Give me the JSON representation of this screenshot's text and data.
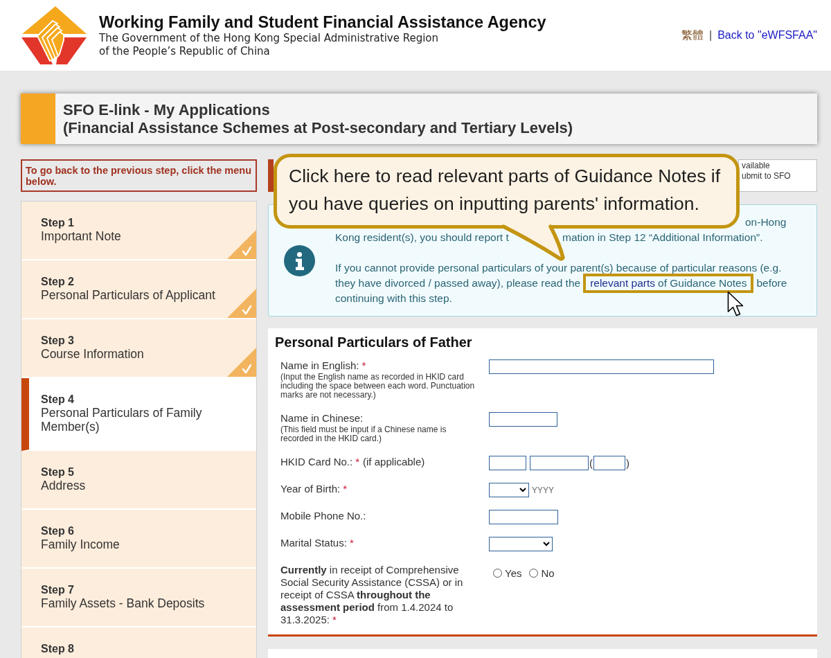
{
  "header": {
    "agency_name": "Working Family and Student Financial Assistance Agency",
    "government_lines": [
      "The Government of the Hong Kong Special Administrative Region",
      "of the People’s Republic of China"
    ],
    "links": [
      {
        "label": "繁體",
        "kind": "language"
      },
      {
        "label": "Back to \"eWFSFAA\"",
        "kind": "back"
      }
    ],
    "separator": "|"
  },
  "banner": {
    "title": "SFO E-link - My Applications",
    "subtitle": "(Financial Assistance Schemes at Post-secondary and Tertiary Levels)"
  },
  "navigation_note": "To go back to the previous step, click the menu below.",
  "steps": [
    {
      "label": "Step 1",
      "title": "Important Note",
      "completed": true,
      "selected": false
    },
    {
      "label": "Step 2",
      "title": "Personal Particulars of Applicant",
      "completed": true,
      "selected": false
    },
    {
      "label": "Step 3",
      "title": "Course Information",
      "completed": true,
      "selected": false
    },
    {
      "label": "Step 4",
      "title": "Personal Particulars of Family Member(s)",
      "completed": false,
      "selected": true
    },
    {
      "label": "Step 5",
      "title": "Address",
      "completed": false,
      "selected": false
    },
    {
      "label": "Step 6",
      "title": "Family Income",
      "completed": false,
      "selected": false
    },
    {
      "label": "Step 7",
      "title": "Family Assets - Bank Deposits",
      "completed": false,
      "selected": false
    },
    {
      "label": "Step 8",
      "completed": false,
      "selected": false
    }
  ],
  "status_box": {
    "lines": [
      "vailable",
      "ubmit to SFO"
    ]
  },
  "callout": {
    "text": "Click here to read relevant parts of Guidance Notes if you have queries on inputting parents' information."
  },
  "info": {
    "paragraphs": [
      {
        "lines": [
          [
            {
              "kind": "text",
              "text": "on-Hong"
            }
          ],
          [
            {
              "kind": "text",
              "text": "Kong resident(s), you should report t"
            },
            {
              "kind": "text",
              "text": "mation in Step 12 “Additional Information”."
            }
          ]
        ]
      },
      {
        "lines": [
          [
            {
              "kind": "text",
              "text": "If you cannot provide personal particulars of your parent(s) because of particular reasons (e.g."
            }
          ],
          [
            {
              "kind": "text",
              "text": "they have divorced / passed away), please read the"
            },
            {
              "kind": "frame",
              "link": "relevant parts",
              "text": "of Guidance Notes"
            },
            {
              "kind": "text",
              "text": "before"
            }
          ],
          [
            {
              "kind": "text",
              "text": "continuing with this step."
            }
          ]
        ]
      }
    ]
  },
  "form": {
    "title": "Personal Particulars of Father",
    "fields": [
      {
        "kind": "text",
        "label": "Name in English:",
        "mark": "*",
        "hint": "(Input the English name as recorded in HKID card including the space between each word. Punctuation marks are not necessary.)"
      },
      {
        "kind": "text",
        "label": "Name in Chinese:",
        "hint": "(This field must be input if a Chinese name is recorded in the HKID card.)"
      },
      {
        "kind": "hkid",
        "label": "HKID Card No.:",
        "mark": "*",
        "note": "(if applicable)",
        "open": "(",
        "close": ")"
      },
      {
        "kind": "select",
        "label": "Year of Birth:",
        "mark": "*",
        "format": "YYYY"
      },
      {
        "kind": "text",
        "label": "Mobile Phone No.:"
      },
      {
        "kind": "select",
        "label": "Marital Status:",
        "mark": "*"
      },
      {
        "kind": "radio",
        "label": "**Currently** in receipt of Comprehensive Social Security Assistance (CSSA) or in receipt of CSSA **throughout the assessment period** from 1.4.2024 to 31.3.2025:",
        "mark": "*",
        "options": [
          {
            "label": "Yes",
            "selected": false
          },
          {
            "label": "No",
            "selected": false
          }
        ]
      }
    ]
  }
}
